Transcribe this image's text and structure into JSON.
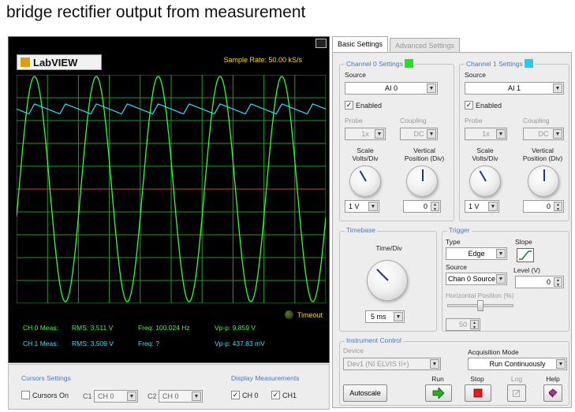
{
  "page_title": "bridge rectifier output from measurement",
  "logo_text": "LabVIEW",
  "sample_rate": "Sample Rate:  50.00 kS/s",
  "timeout_label": "Timeout",
  "colors": {
    "ch0": "#31ff31",
    "ch1": "#2ee0ff",
    "grid": "#1f9d1f",
    "center": "#d04040",
    "accent": "#4b79b8"
  },
  "measurements": {
    "ch0": {
      "label": "CH 0 Meas:",
      "rms": "RMS:  3.511 V",
      "freq": "Freq:  100.024 Hz",
      "vpp": "Vp-p:  9.859 V"
    },
    "ch1": {
      "label": "CH 1 Meas:",
      "rms": "RMS:  3.509 V",
      "freq": "Freq:  ?",
      "vpp": "Vp-p:  437.83 mV"
    }
  },
  "cursors": {
    "title": "Cursors Settings",
    "cursors_on": "Cursors On",
    "c1_label": "C1",
    "c1_value": "CH 0",
    "c2_label": "C2",
    "c2_value": "CH 0"
  },
  "display_meas": {
    "title": "Display Measurements",
    "ch0": "CH 0",
    "ch1": "CH1"
  },
  "tabs": {
    "basic": "Basic Settings",
    "advanced": "Advanced Settings"
  },
  "channel0": {
    "title": "Channel 0 Settings",
    "swatch": "#22e022",
    "source_label": "Source",
    "source": "AI 0",
    "enabled": "Enabled",
    "probe_label": "Probe",
    "probe": "1x",
    "coupling_label": "Coupling",
    "coupling": "DC",
    "scale_label1": "Scale",
    "scale_label2": "Volts/Div",
    "vpos_label1": "Vertical",
    "vpos_label2": "Position (Div)",
    "scale_value": "1 V",
    "vpos_value": "0"
  },
  "channel1": {
    "title": "Channel 1 Settings",
    "swatch": "#22ccf0",
    "source_label": "Source",
    "source": "AI 1",
    "enabled": "Enabled",
    "probe_label": "Probe",
    "probe": "1x",
    "coupling_label": "Coupling",
    "coupling": "DC",
    "scale_label1": "Scale",
    "scale_label2": "Volts/Div",
    "vpos_label1": "Vertical",
    "vpos_label2": "Position (Div)",
    "scale_value": "1 V",
    "vpos_value": "0"
  },
  "timebase": {
    "title": "Timebase",
    "label": "Time/Div",
    "value": "5 ms"
  },
  "trigger": {
    "title": "Trigger",
    "type_label": "Type",
    "type": "Edge",
    "slope_label": "Slope",
    "source_label": "Source",
    "source": "Chan 0 Source",
    "level_label": "Level (V)",
    "level": "0",
    "hpos_label": "Horizontal Position (%)",
    "hpos": "50"
  },
  "instrument": {
    "title": "Instrument Control",
    "device_label": "Device",
    "device": "Dev1 (NI ELVIS II+)",
    "acq_label": "Acquisition Mode",
    "acq": "Run Continuously",
    "autoscale": "Autoscale",
    "run": "Run",
    "stop": "Stop",
    "log": "Log",
    "help": "Help"
  }
}
